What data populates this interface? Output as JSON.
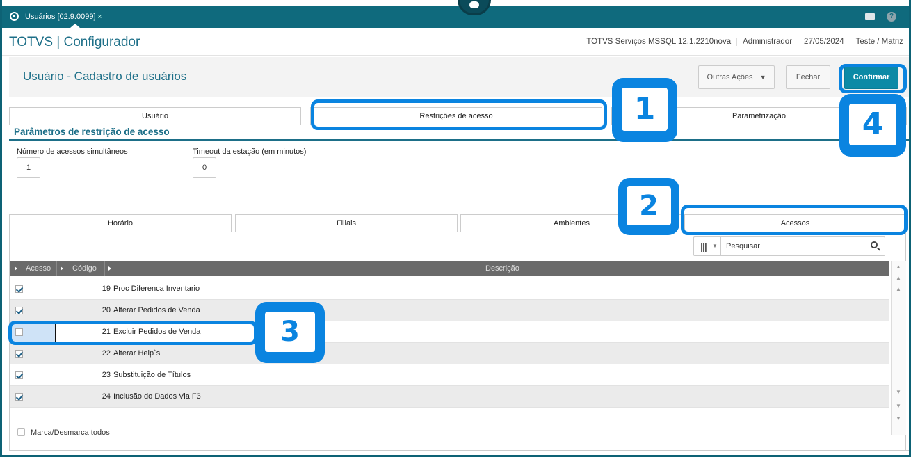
{
  "topbar": {
    "tab_label": "Usuários [02.9.0099]",
    "close": "×",
    "help": "?"
  },
  "header": {
    "app_title": "TOTVS | Configurador",
    "info": [
      "TOTVS Serviços MSSQL 12.1.2210nova",
      "Administrador",
      "27/05/2024",
      "Teste / Matriz"
    ]
  },
  "page": {
    "title": "Usuário - Cadastro de usuários",
    "buttons": {
      "outras": "Outras Ações",
      "fechar": "Fechar",
      "confirmar": "Confirmar"
    }
  },
  "main_tabs": [
    "Usuário",
    "Restrições de acesso",
    "Parametrização"
  ],
  "section": {
    "title": "Parâmetros de restrição de acesso",
    "fields": [
      {
        "label": "Número de acessos simultâneos",
        "value": "1"
      },
      {
        "label": "Timeout da estação (em minutos)",
        "value": "0"
      }
    ]
  },
  "sub_tabs": [
    "Horário",
    "Filiais",
    "Ambientes",
    "Acessos"
  ],
  "search": {
    "placeholder": "Pesquisar"
  },
  "grid": {
    "headers": [
      "Acesso",
      "Código",
      "Descrição"
    ],
    "rows": [
      {
        "code": "19",
        "desc": "Proc Diferenca Inventario",
        "checked": true
      },
      {
        "code": "20",
        "desc": "Alterar Pedidos de Venda",
        "checked": true
      },
      {
        "code": "21",
        "desc": "Excluir Pedidos de Venda",
        "checked": false
      },
      {
        "code": "22",
        "desc": "Alterar Help`s",
        "checked": true
      },
      {
        "code": "23",
        "desc": "Substituição de Títulos",
        "checked": true
      },
      {
        "code": "24",
        "desc": "Inclusão do Dados Via F3",
        "checked": true
      }
    ]
  },
  "marca_label": "Marca/Desmarca todos",
  "callouts": [
    "1",
    "2",
    "3",
    "4"
  ],
  "colors": {
    "accent": "#0f6a7d",
    "callout": "#0a84e0",
    "confirm": "#0c8aa6"
  }
}
